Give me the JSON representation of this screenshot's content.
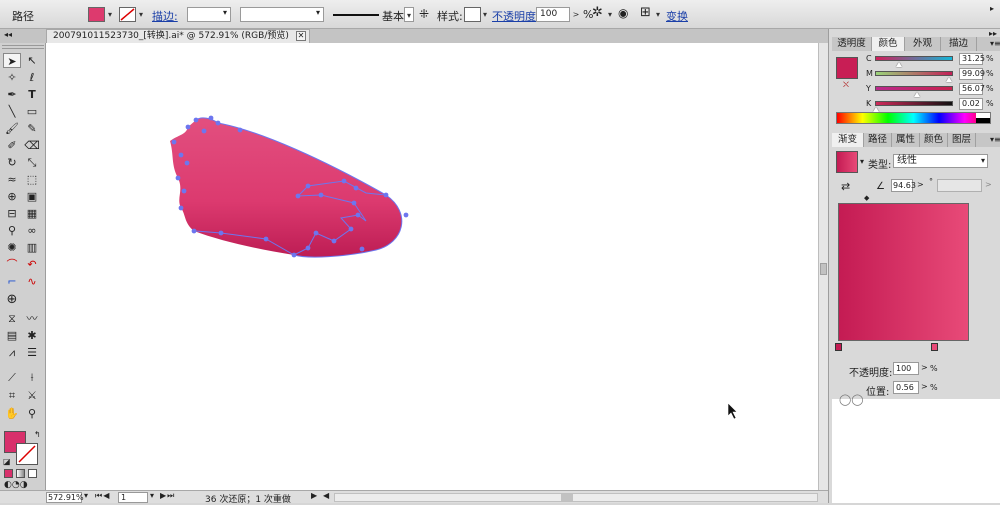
{
  "control_bar": {
    "object_type": "路径",
    "stroke_link": "描边:",
    "brush_label": "基本",
    "style_label": "样式:",
    "opacity_link": "不透明度:",
    "opacity_value": "100",
    "opacity_unit": "%",
    "transform_link": "变换",
    "fill_color": "#dd3a6e"
  },
  "document": {
    "tab_title": "200791011523730_[转换].ai* @ 572.91% (RGB/预览)"
  },
  "status": {
    "zoom": "572.91%",
    "artboard": "1",
    "message": "36 次还原；1 次重做"
  },
  "color_panel": {
    "tabs": [
      "透明度",
      "颜色",
      "外观",
      "描边"
    ],
    "active_tab": "颜色",
    "swatch": "#c81e55",
    "channels": [
      {
        "name": "C",
        "value": "31.25",
        "unit": "%",
        "fraction": 0.31,
        "gradient": "linear-gradient(90deg,#d01e5a,#13b7d8)"
      },
      {
        "name": "M",
        "value": "99.09",
        "unit": "%",
        "fraction": 0.99,
        "gradient": "linear-gradient(90deg,#9bd47a,#c21f57)"
      },
      {
        "name": "Y",
        "value": "56.07",
        "unit": "%",
        "fraction": 0.56,
        "gradient": "linear-gradient(90deg,#bb2a8c,#c8224f)"
      },
      {
        "name": "K",
        "value": "0.02",
        "unit": "%",
        "fraction": 0.0,
        "gradient": "linear-gradient(90deg,#cf2a5a,#111111)"
      }
    ]
  },
  "gradient_panel": {
    "tabs": [
      "渐变",
      "路径",
      "属性",
      "颜色",
      "图层"
    ],
    "active_tab": "渐变",
    "type_label": "类型:",
    "type_value": "线性",
    "angle_value": "94.63",
    "angle_unit": "°",
    "start_color": "#c41b53",
    "end_color": "#e84a78",
    "opacity_label": "不透明度:",
    "opacity_value": "100",
    "opacity_unit": "%",
    "position_label": "位置:",
    "position_value": "0.56",
    "position_unit": "%"
  }
}
